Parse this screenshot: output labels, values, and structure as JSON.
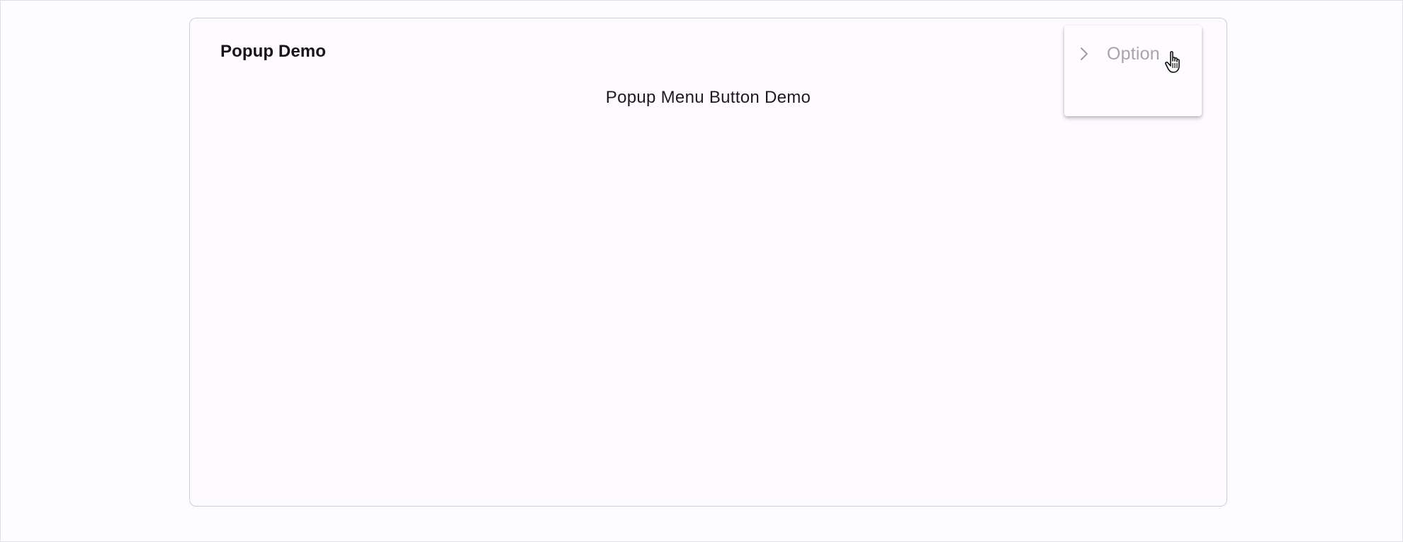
{
  "card": {
    "title": "Popup Demo",
    "subtitle": "Popup Menu Button Demo"
  },
  "popup_menu": {
    "items": [
      {
        "label": "Option",
        "icon": "chevron-right-icon"
      }
    ]
  },
  "colors": {
    "background": "#fdfcfe",
    "card_border": "#cfccd3",
    "menu_text_disabled": "#a7a5aa",
    "title_text": "#16141a"
  },
  "cursor": {
    "icon": "hand-pointer-cursor-icon"
  }
}
